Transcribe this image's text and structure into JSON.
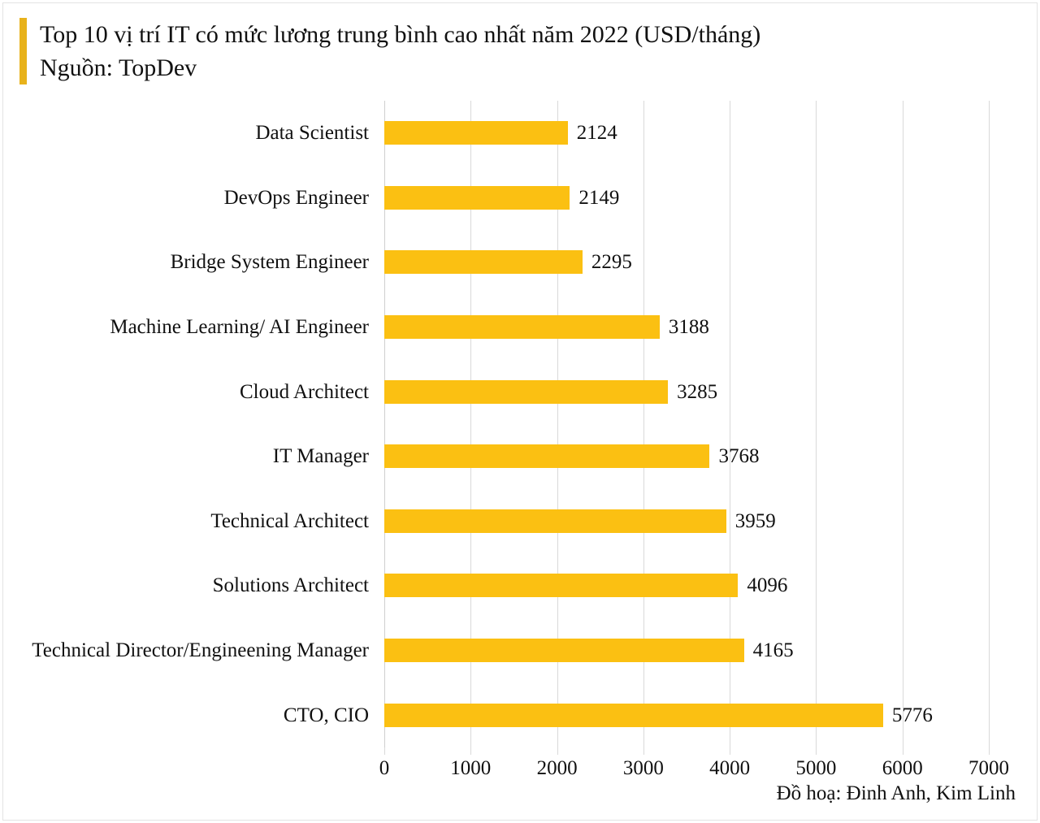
{
  "title": {
    "line1": "Top 10 vị trí IT có mức lương trung bình cao nhất năm 2022 (USD/tháng)",
    "line2": "Nguồn: TopDev",
    "accent_color": "#E8B21B"
  },
  "credit": "Đồ hoạ: Đinh Anh, Kim Linh",
  "chart_data": {
    "type": "bar",
    "orientation": "horizontal",
    "title": "Top 10 vị trí IT có mức lương trung bình cao nhất năm 2022 (USD/tháng)",
    "subtitle": "Nguồn: TopDev",
    "xlabel": "",
    "ylabel": "",
    "xlim": [
      0,
      7000
    ],
    "xticks": [
      "0",
      "1000",
      "2000",
      "3000",
      "4000",
      "5000",
      "6000",
      "7000"
    ],
    "xtick_values": [
      0,
      1000,
      2000,
      3000,
      4000,
      5000,
      6000,
      7000
    ],
    "grid": true,
    "grid_axis": "x",
    "legend": false,
    "bar_color": "#FBC012",
    "data_labels": true,
    "categories": [
      "Data Scientist",
      "DevOps Engineer",
      "Bridge System Engineer",
      "Machine Learning/ AI Engineer",
      "Cloud Architect",
      "IT Manager",
      "Technical Architect",
      "Solutions Architect",
      "Technical Director/Engineening Manager",
      "CTO, CIO"
    ],
    "values": [
      2124,
      2149,
      2295,
      3188,
      3285,
      3768,
      3959,
      4096,
      4165,
      5776
    ],
    "labels": [
      "2124",
      "2149",
      "2295",
      "3188",
      "3285",
      "3768",
      "3959",
      "4096",
      "4165",
      "5776"
    ]
  }
}
